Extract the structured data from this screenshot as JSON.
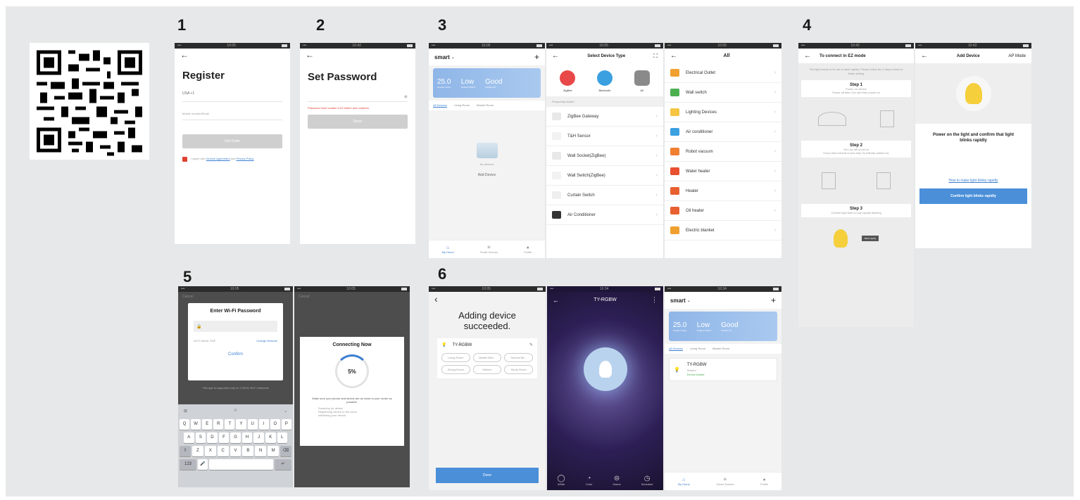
{
  "steps": [
    "1",
    "2",
    "3",
    "4",
    "5",
    "6"
  ],
  "s1": {
    "title": "Register",
    "country": "USA +1",
    "email_placeholder": "Mobile number/Email",
    "button": "Get Code",
    "agree_text": "I agree with",
    "agreement_link": "Service Agreement",
    "and_text": "and",
    "privacy_link": "Privacy Policy"
  },
  "s2": {
    "title": "Set Password",
    "hint": "Password must contain 6-20 letters and numbers",
    "button": "Done"
  },
  "s3a": {
    "home_name": "smart",
    "weather": [
      {
        "value": "25.0",
        "label": "Outdoor Temp."
      },
      {
        "value": "Low",
        "label": "Outdoor PM2.5"
      },
      {
        "value": "Good",
        "label": "Outdoor Air"
      }
    ],
    "tabs": [
      "All Devices",
      "Living Room",
      "Master Room"
    ],
    "empty_text": "No devices",
    "add_device": "Add Device",
    "tabbar": [
      "My Home",
      "Smart Scenes",
      "Profile"
    ]
  },
  "s3b": {
    "title": "Select Device Type",
    "top_items": [
      "ZigBee",
      "Bluetooth",
      "All"
    ],
    "section": "Frequently Added",
    "items": [
      "ZigBee Gateway",
      "T&H Sensor",
      "Wall Socket(ZigBee)",
      "Wall Switch(ZigBee)",
      "Curtain Switch",
      "Air Conditioner"
    ]
  },
  "s3c": {
    "title": "All",
    "items": [
      "Electrical Outlet",
      "Wall switch",
      "Lighting Devices",
      "Air conditioner",
      "Robot vacuum",
      "Water heater",
      "Heater",
      "Oil heater",
      "Electric blanket"
    ],
    "colors": [
      "#f0a030",
      "#4caf50",
      "#f5c542",
      "#3aa0e0",
      "#f08030",
      "#e85030",
      "#e86030",
      "#e86030",
      "#f0a030"
    ]
  },
  "s4a": {
    "title": "To connect in EZ mode",
    "intro": "The light needs to be set to flash rapidly. Please follow the 3 steps below to finish setting",
    "step1": "Step 1",
    "step1_text": "Power on device",
    "step1_sub": "Power off after 10s and then power on",
    "step2": "Step 2",
    "step2_text": "Turn on-off-on-off-on",
    "step2_sub": "Every time interval is less than 2s (Strictly adhere to)",
    "step3": "Step 3",
    "step3_text": "Confirm light bulb is now rapidly flashing",
    "badge": "Blink rapidly"
  },
  "s4b": {
    "title": "Add Device",
    "mode": "AP Mode",
    "text": "Power on the light and confirm that light blinks rapidly",
    "link": "How to make light blinks rapidly",
    "button": "Confirm light blinks rapidly"
  },
  "s5a": {
    "cancel": "Cancel",
    "dialog_title": "Enter Wi-Fi Password",
    "wifi_name": "Wi-Fi Name: EAP",
    "change": "Change Network",
    "confirm": "Confirm",
    "note": "This app is supported only on 2.4GHz Wi-Fi networks",
    "keyrow1": [
      "Q",
      "W",
      "E",
      "R",
      "T",
      "Y",
      "U",
      "I",
      "O",
      "P"
    ],
    "keyrow2": [
      "A",
      "S",
      "D",
      "F",
      "G",
      "H",
      "J",
      "K",
      "L"
    ],
    "keyrow3": [
      "Z",
      "X",
      "C",
      "V",
      "B",
      "N",
      "M"
    ],
    "keyrow4": [
      "123"
    ]
  },
  "s5b": {
    "cancel": "Cancel",
    "title": "Connecting Now",
    "percent": "5%",
    "desc": "Make sure your phone and device are as close to your router as possible.",
    "steps": [
      "Scanning for device",
      "Registering device to the cloud",
      "Initializing your device"
    ]
  },
  "s6a": {
    "title": "Adding device succeeded.",
    "device": "TY-RGBW",
    "rooms": [
      "Living Room",
      "Master Bed...",
      "Second Be...",
      "Dining Room",
      "Kitchen",
      "Study Room"
    ],
    "button": "Done"
  },
  "s6b": {
    "title": "TY-RGBW",
    "modes": [
      "White",
      "Color",
      "Scene",
      "Schedule"
    ]
  },
  "s6c": {
    "home_name": "smart",
    "weather": [
      {
        "value": "25.0",
        "label": "Outdoor Temp."
      },
      {
        "value": "Low",
        "label": "Outdoor PM2.5"
      },
      {
        "value": "Good",
        "label": "Outdoor Air"
      }
    ],
    "tabs": [
      "All Devices",
      "Living Room",
      "Master Room"
    ],
    "device": "TY-RGBW",
    "device_room": "Shared",
    "device_status": "Device Added",
    "tabbar": [
      "My Home",
      "Smart Scenes",
      "Profile"
    ]
  }
}
